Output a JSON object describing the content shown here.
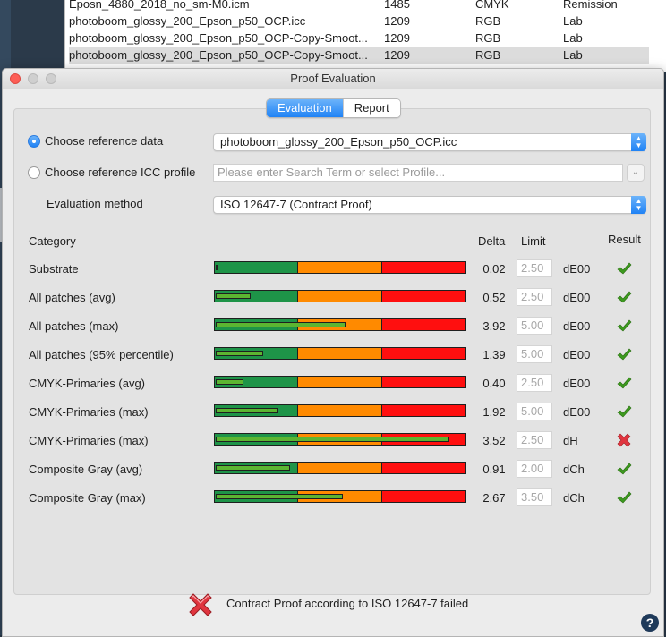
{
  "profiles": [
    {
      "name": "Eposn_4880_2018_no_sm-M0.icm",
      "size": "1485",
      "space": "CMYK",
      "type": "Remission",
      "selected": false
    },
    {
      "name": "photoboom_glossy_200_Epson_p50_OCP.icc",
      "size": "1209",
      "space": "RGB",
      "type": "Lab",
      "selected": false
    },
    {
      "name": "photoboom_glossy_200_Epson_p50_OCP-Copy-Smoot...",
      "size": "1209",
      "space": "RGB",
      "type": "Lab",
      "selected": false
    },
    {
      "name": "photoboom_glossy_200_Epson_p50_OCP-Copy-Smoot...",
      "size": "1209",
      "space": "RGB",
      "type": "Lab",
      "selected": true
    }
  ],
  "window": {
    "title": "Proof Evaluation"
  },
  "tabs": [
    {
      "label": "Evaluation",
      "active": true
    },
    {
      "label": "Report",
      "active": false
    }
  ],
  "reference": {
    "data_label": "Choose reference data",
    "data_value": "photoboom_glossy_200_Epson_p50_OCP.icc",
    "icc_label": "Choose reference ICC profile",
    "icc_placeholder": "Please enter Search Term or select Profile...",
    "selected": "data"
  },
  "method": {
    "label": "Evaluation method",
    "value": "ISO 12647-7 (Contract Proof)"
  },
  "headers": {
    "category": "Category",
    "delta": "Delta",
    "limit": "Limit",
    "result": "Result"
  },
  "rows": [
    {
      "category": "Substrate",
      "delta": "0.02",
      "limit": "2.50",
      "unit": "dE00",
      "fill": 0.008,
      "passed": true
    },
    {
      "category": "All patches (avg)",
      "delta": "0.52",
      "limit": "2.50",
      "unit": "dE00",
      "fill": 0.14,
      "passed": true
    },
    {
      "category": "All patches (max)",
      "delta": "3.92",
      "limit": "5.00",
      "unit": "dE00",
      "fill": 0.52,
      "passed": true
    },
    {
      "category": "All patches (95% percentile)",
      "delta": "1.39",
      "limit": "5.00",
      "unit": "dE00",
      "fill": 0.19,
      "passed": true
    },
    {
      "category": "CMYK-Primaries (avg)",
      "delta": "0.40",
      "limit": "2.50",
      "unit": "dE00",
      "fill": 0.11,
      "passed": true
    },
    {
      "category": "CMYK-Primaries (max)",
      "delta": "1.92",
      "limit": "5.00",
      "unit": "dE00",
      "fill": 0.25,
      "passed": true
    },
    {
      "category": "CMYK-Primaries (max)",
      "delta": "3.52",
      "limit": "2.50",
      "unit": "dH",
      "fill": 0.94,
      "passed": false
    },
    {
      "category": "Composite Gray (avg)",
      "delta": "0.91",
      "limit": "2.00",
      "unit": "dCh",
      "fill": 0.3,
      "passed": true
    },
    {
      "category": "Composite Gray (max)",
      "delta": "2.67",
      "limit": "3.50",
      "unit": "dCh",
      "fill": 0.51,
      "passed": true
    }
  ],
  "summary": {
    "text": "Contract Proof according to ISO 12647-7 failed",
    "passed": false
  },
  "help": {
    "label": "?"
  },
  "colors": {
    "accent": "#1f82f5",
    "zone_good": "#1e9448",
    "zone_warn": "#ff8a00",
    "zone_bad": "#ff0f0f",
    "indicator": "#5cb531",
    "check": "#3d9a1f",
    "cross": "#e0353f"
  }
}
